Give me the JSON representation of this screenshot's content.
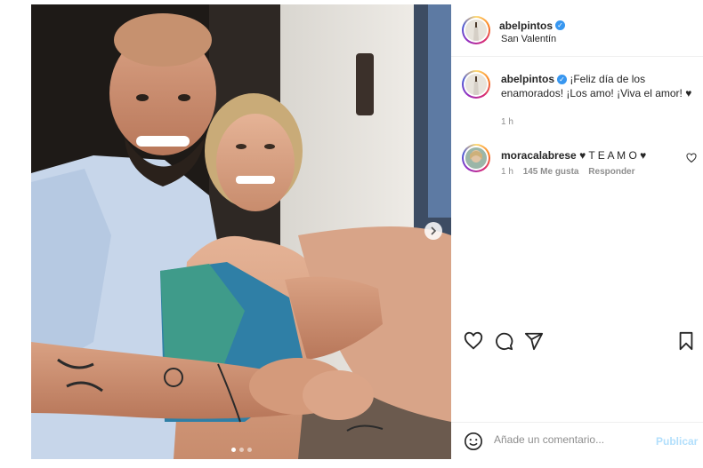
{
  "post": {
    "username": "abelpintos",
    "location": "San Valentín",
    "verified_icon": "verified-badge-icon",
    "caption": "¡Feliz día de los enamorados! ¡Los amo! ¡Viva el amor! ♥",
    "caption_time": "1 h"
  },
  "comments": [
    {
      "username": "moracalabrese",
      "text": "♥ T E A M O ♥",
      "time": "1 h",
      "likes": "145 Me gusta",
      "reply_label": "Responder"
    }
  ],
  "actions": {
    "like_icon": "heart-icon",
    "comment_icon": "comment-bubble-icon",
    "share_icon": "paper-plane-icon",
    "save_icon": "bookmark-icon"
  },
  "add_comment": {
    "placeholder": "Añade un comentario...",
    "publish_label": "Publicar",
    "emoji_icon": "emoji-icon"
  },
  "carousel": {
    "slides": 3,
    "active": 1
  },
  "colors": {
    "verified": "#3897f0",
    "publish": "#b2dffc",
    "meta": "#8e8e8e"
  }
}
